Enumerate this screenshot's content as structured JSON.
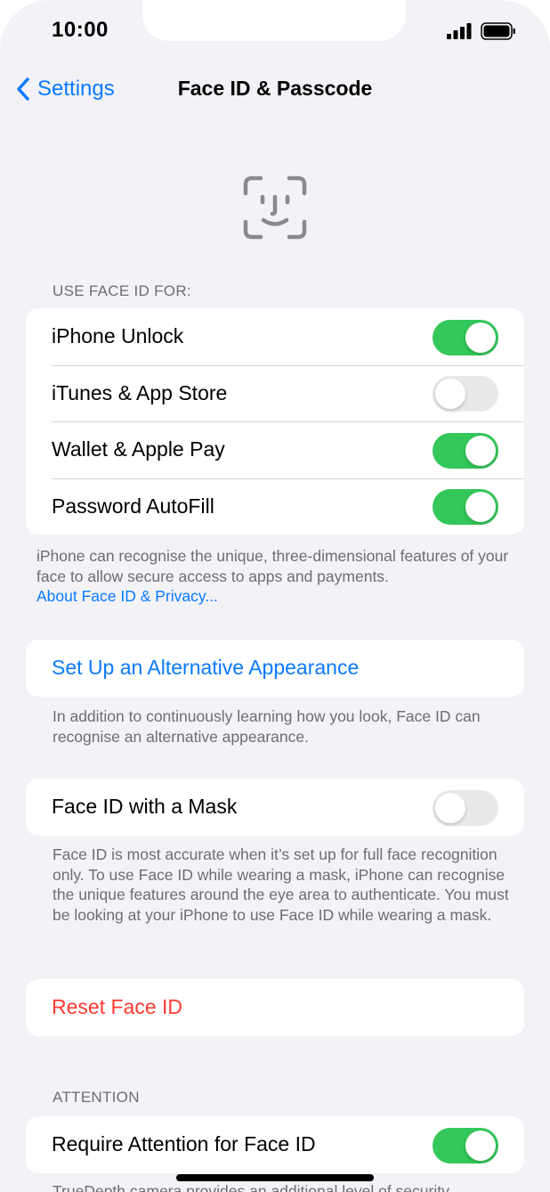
{
  "status_bar": {
    "time": "10:00",
    "signal_icon": "cellular-signal-icon",
    "battery_icon": "battery-icon"
  },
  "nav": {
    "back_label": "Settings",
    "back_icon": "chevron-left-icon",
    "title": "Face ID & Passcode"
  },
  "hero_icon": "face-id-icon",
  "use_face_id": {
    "header": "USE FACE ID FOR:",
    "items": [
      {
        "label": "iPhone Unlock",
        "on": true
      },
      {
        "label": "iTunes & App Store",
        "on": false
      },
      {
        "label": "Wallet & Apple Pay",
        "on": true
      },
      {
        "label": "Password AutoFill",
        "on": true
      }
    ],
    "footer": "iPhone can recognise the unique, three-dimensional features of your face to allow secure access to apps and payments.",
    "footer_link": "About Face ID & Privacy..."
  },
  "alternative": {
    "label": "Set Up an Alternative Appearance",
    "footer": "In addition to continuously learning how you look, Face ID can recognise an alternative appearance."
  },
  "mask": {
    "label": "Face ID with a Mask",
    "on": false,
    "footer": "Face ID is most accurate when it’s set up for full face recognition only. To use Face ID while wearing a mask, iPhone can recognise the unique features around the eye area to authenticate. You must be looking at your iPhone to use Face ID while wearing a mask."
  },
  "reset": {
    "label": "Reset Face ID"
  },
  "attention": {
    "header": "ATTENTION",
    "label": "Require Attention for Face ID",
    "on": true,
    "footer_partial": "TrueDepth camera provides an additional level of security"
  },
  "colors": {
    "accent_blue": "#0a7aff",
    "toggle_on": "#34c759",
    "toggle_off": "#e9e9eb",
    "destructive_red": "#ff3b30",
    "background": "#f2f2f7"
  }
}
